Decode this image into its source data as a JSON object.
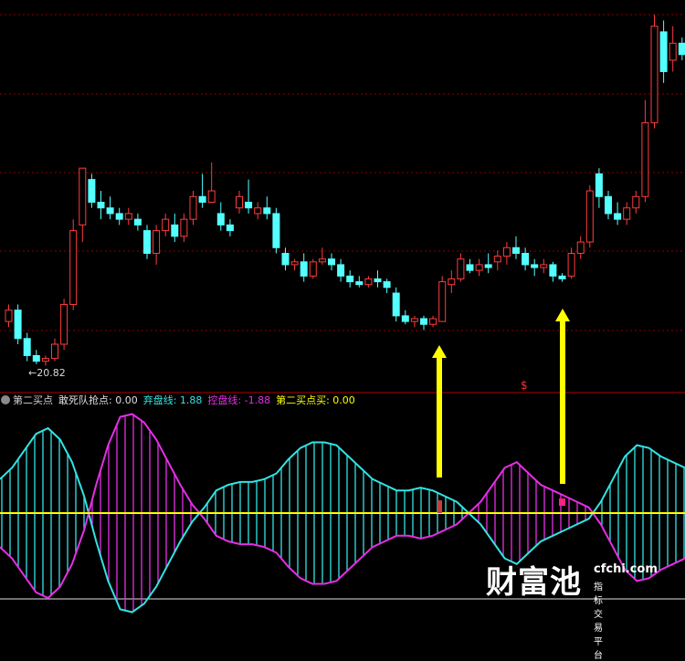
{
  "chart_data": {
    "type": "candlestick+oscillator",
    "price_panel": {
      "low_marker": "←20.82",
      "signal_label": "$",
      "candles": [
        [
          21.6,
          21.9,
          21.5,
          21.8
        ],
        [
          21.8,
          21.9,
          21.2,
          21.3
        ],
        [
          21.3,
          21.4,
          20.9,
          21.0
        ],
        [
          21.0,
          21.1,
          20.85,
          20.9
        ],
        [
          20.9,
          21.0,
          20.82,
          20.95
        ],
        [
          20.95,
          21.3,
          20.9,
          21.2
        ],
        [
          21.2,
          22.0,
          21.1,
          21.9
        ],
        [
          21.9,
          23.4,
          21.8,
          23.2
        ],
        [
          23.3,
          24.3,
          23.0,
          24.3
        ],
        [
          24.1,
          24.2,
          23.6,
          23.7
        ],
        [
          23.7,
          23.9,
          23.4,
          23.6
        ],
        [
          23.6,
          23.8,
          23.4,
          23.5
        ],
        [
          23.5,
          23.6,
          23.3,
          23.4
        ],
        [
          23.4,
          23.6,
          23.3,
          23.5
        ],
        [
          23.4,
          23.5,
          23.2,
          23.3
        ],
        [
          23.2,
          23.3,
          22.7,
          22.8
        ],
        [
          22.8,
          23.3,
          22.6,
          23.2
        ],
        [
          23.2,
          23.5,
          23.1,
          23.4
        ],
        [
          23.3,
          23.5,
          23.0,
          23.1
        ],
        [
          23.1,
          23.5,
          23.0,
          23.4
        ],
        [
          23.4,
          23.9,
          23.3,
          23.8
        ],
        [
          23.8,
          24.2,
          23.6,
          23.7
        ],
        [
          23.7,
          24.4,
          23.7,
          23.9
        ],
        [
          23.5,
          23.7,
          23.2,
          23.3
        ],
        [
          23.3,
          23.4,
          23.1,
          23.2
        ],
        [
          23.6,
          23.9,
          23.5,
          23.8
        ],
        [
          23.7,
          24.1,
          23.5,
          23.6
        ],
        [
          23.5,
          23.7,
          23.4,
          23.6
        ],
        [
          23.6,
          23.8,
          23.4,
          23.5
        ],
        [
          23.5,
          23.6,
          22.8,
          22.9
        ],
        [
          22.8,
          22.9,
          22.5,
          22.6
        ],
        [
          22.6,
          22.7,
          22.5,
          22.65
        ],
        [
          22.65,
          22.8,
          22.3,
          22.4
        ],
        [
          22.4,
          22.7,
          22.35,
          22.65
        ],
        [
          22.65,
          22.9,
          22.6,
          22.7
        ],
        [
          22.7,
          22.8,
          22.5,
          22.6
        ],
        [
          22.6,
          22.7,
          22.3,
          22.4
        ],
        [
          22.4,
          22.5,
          22.2,
          22.3
        ],
        [
          22.3,
          22.4,
          22.2,
          22.25
        ],
        [
          22.25,
          22.4,
          22.2,
          22.35
        ],
        [
          22.35,
          22.5,
          22.2,
          22.3
        ],
        [
          22.3,
          22.35,
          22.1,
          22.2
        ],
        [
          22.1,
          22.2,
          21.6,
          21.7
        ],
        [
          21.7,
          21.8,
          21.55,
          21.6
        ],
        [
          21.6,
          21.7,
          21.5,
          21.65
        ],
        [
          21.65,
          21.7,
          21.45,
          21.55
        ],
        [
          21.55,
          21.7,
          21.5,
          21.65
        ],
        [
          21.6,
          22.4,
          21.6,
          22.3
        ],
        [
          22.25,
          22.5,
          22.1,
          22.35
        ],
        [
          22.35,
          22.8,
          22.3,
          22.7
        ],
        [
          22.6,
          22.7,
          22.45,
          22.5
        ],
        [
          22.5,
          22.7,
          22.4,
          22.6
        ],
        [
          22.6,
          22.8,
          22.45,
          22.55
        ],
        [
          22.65,
          22.85,
          22.5,
          22.75
        ],
        [
          22.75,
          23.0,
          22.6,
          22.9
        ],
        [
          22.9,
          23.1,
          22.7,
          22.8
        ],
        [
          22.8,
          22.9,
          22.5,
          22.6
        ],
        [
          22.6,
          22.7,
          22.4,
          22.55
        ],
        [
          22.55,
          22.7,
          22.45,
          22.6
        ],
        [
          22.6,
          22.65,
          22.3,
          22.4
        ],
        [
          22.4,
          22.45,
          22.3,
          22.35
        ],
        [
          22.4,
          22.9,
          22.35,
          22.8
        ],
        [
          22.8,
          23.1,
          22.7,
          23.0
        ],
        [
          23.0,
          24.0,
          22.9,
          23.9
        ],
        [
          24.2,
          24.3,
          23.6,
          23.8
        ],
        [
          23.8,
          23.9,
          23.4,
          23.5
        ],
        [
          23.5,
          23.7,
          23.3,
          23.4
        ],
        [
          23.4,
          23.7,
          23.3,
          23.6
        ],
        [
          23.6,
          23.9,
          23.5,
          23.8
        ],
        [
          23.8,
          25.5,
          23.7,
          25.1
        ],
        [
          25.1,
          27.0,
          25.0,
          26.8
        ],
        [
          26.7,
          26.9,
          25.8,
          26.0
        ],
        [
          26.2,
          26.8,
          26.0,
          26.5
        ],
        [
          26.5,
          26.6,
          26.2,
          26.3
        ]
      ]
    },
    "oscillator_panel": {
      "baseline": 0,
      "series": [
        {
          "name": "弃盘线",
          "color": "#33e3e3",
          "values": [
            0.6,
            0.8,
            1.1,
            1.4,
            1.5,
            1.3,
            0.9,
            0.3,
            -0.5,
            -1.2,
            -1.7,
            -1.75,
            -1.6,
            -1.3,
            -0.9,
            -0.5,
            -0.15,
            0.1,
            0.4,
            0.5,
            0.55,
            0.55,
            0.6,
            0.7,
            0.95,
            1.15,
            1.25,
            1.25,
            1.2,
            1.0,
            0.8,
            0.6,
            0.5,
            0.4,
            0.4,
            0.45,
            0.4,
            0.3,
            0.2,
            0.0,
            -0.2,
            -0.5,
            -0.8,
            -0.9,
            -0.7,
            -0.5,
            -0.4,
            -0.3,
            -0.2,
            -0.1,
            0.2,
            0.6,
            1.0,
            1.2,
            1.15,
            1.0,
            0.9,
            0.8
          ]
        },
        {
          "name": "控盘线",
          "color": "#e62ee6",
          "values": [
            -0.6,
            -0.8,
            -1.1,
            -1.4,
            -1.5,
            -1.3,
            -0.9,
            -0.3,
            0.5,
            1.2,
            1.7,
            1.75,
            1.6,
            1.3,
            0.9,
            0.5,
            0.15,
            -0.1,
            -0.4,
            -0.5,
            -0.55,
            -0.55,
            -0.6,
            -0.7,
            -0.95,
            -1.15,
            -1.25,
            -1.25,
            -1.2,
            -1.0,
            -0.8,
            -0.6,
            -0.5,
            -0.4,
            -0.4,
            -0.45,
            -0.4,
            -0.3,
            -0.2,
            0.0,
            0.2,
            0.5,
            0.8,
            0.9,
            0.7,
            0.5,
            0.4,
            0.3,
            0.2,
            0.1,
            -0.2,
            -0.6,
            -1.0,
            -1.2,
            -1.15,
            -1.0,
            -0.9,
            -0.8
          ]
        }
      ]
    }
  },
  "legend": {
    "name": "第二买点",
    "t1": "敢死队抢点: 0.00",
    "t2": "弃盘线: 1.88",
    "t3": "控盘线: -1.88",
    "t4": "第二买点买: 0.00"
  },
  "colors": {
    "up": "#ff3c3c",
    "down": "#54ffff",
    "grid": "#8b0000",
    "cyan": "#33e3e3",
    "magenta": "#e62ee6",
    "yellow": "#ffff00",
    "white": "#e0e0e0"
  },
  "watermark": {
    "brand": "财富池",
    "site": "cfchi.com",
    "tagline": "指标交易平台"
  }
}
